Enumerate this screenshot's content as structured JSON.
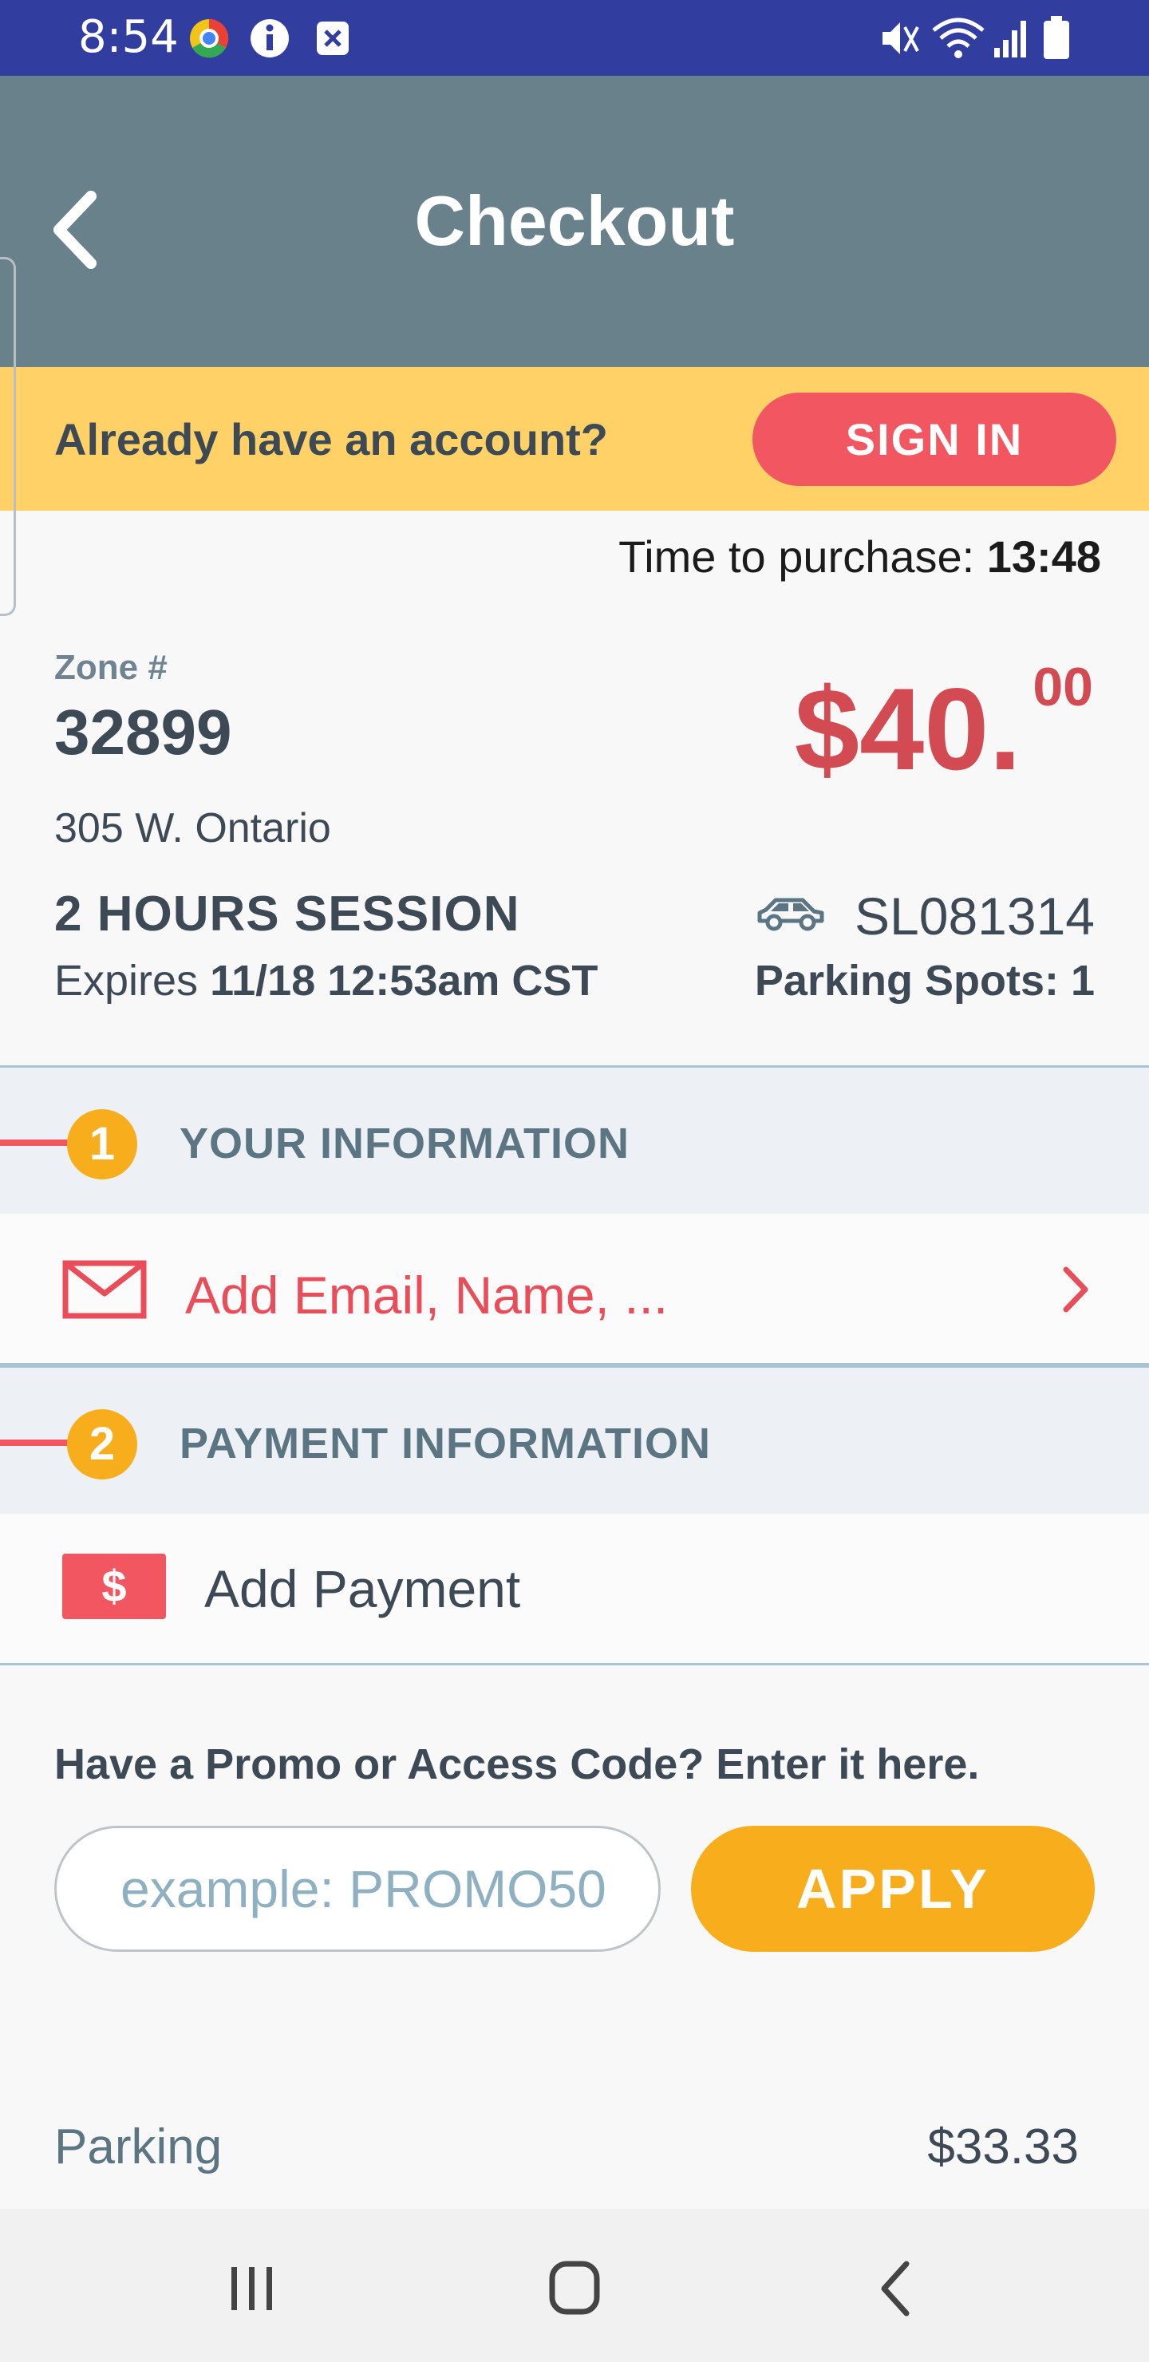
{
  "status_bar": {
    "time": "8:54",
    "icons": [
      "chrome-icon",
      "info-icon",
      "close-box-icon",
      "mute-icon",
      "wifi-icon",
      "signal-icon",
      "battery-icon"
    ]
  },
  "header": {
    "title": "Checkout",
    "back_icon": "chevron-left-icon"
  },
  "account_bar": {
    "question": "Already have an account?",
    "sign_in_label": "SIGN IN"
  },
  "timer": {
    "label": "Time to purchase:",
    "value": "13:48"
  },
  "zone": {
    "label": "Zone #",
    "number": "32899",
    "address": "305 W. Ontario",
    "price_main": "$40.",
    "price_cents": "00"
  },
  "session": {
    "title": "2 HOURS  SESSION",
    "expires_label": "Expires",
    "expires_value": "11/18 12:53am CST",
    "vehicle_plate": "SL081314",
    "parking_spots": "Parking Spots: 1"
  },
  "sections": [
    {
      "number": "1",
      "label": "YOUR INFORMATION"
    },
    {
      "number": "2",
      "label": "PAYMENT INFORMATION"
    }
  ],
  "your_information": {
    "add_label": "Add Email, Name, ..."
  },
  "payment_information": {
    "icon_glyph": "$",
    "add_label": "Add Payment"
  },
  "promo": {
    "question": "Have a Promo or Access Code? Enter it here.",
    "placeholder": "example: PROMO50",
    "apply_label": "APPLY"
  },
  "summary": [
    {
      "label": "Parking",
      "value": "$33.33"
    }
  ],
  "colors": {
    "status_bar": "#323da0",
    "app_bar": "#68818b",
    "account_bar": "#ffd166",
    "accent_red": "#f25660",
    "accent_orange": "#f8ad1d"
  }
}
